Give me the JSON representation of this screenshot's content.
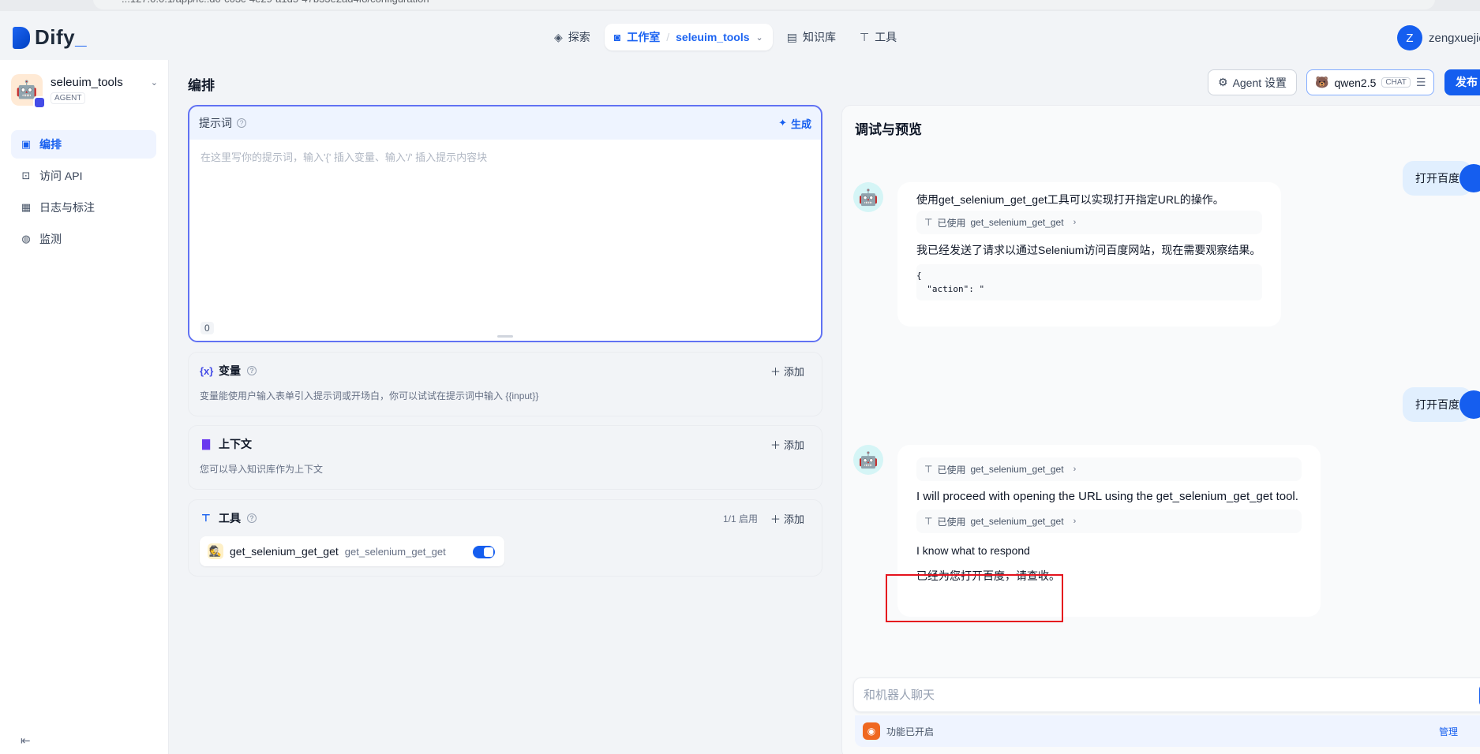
{
  "browser": {
    "url": "...127.0.0.1/app/fc..d0-c03c-4e29-a1d5-47b33e2ad4f8/configuration"
  },
  "nav": {
    "logo": "Dify",
    "explore": "探索",
    "studio": "工作室",
    "current_app": "seleuim_tools",
    "knowledge": "知识库",
    "tools": "工具",
    "user_initial": "Z",
    "user_name": "zengxuejie"
  },
  "sidebar": {
    "app_name": "seleuim_tools",
    "app_type": "AGENT",
    "items": [
      {
        "label": "编排",
        "icon": "layout-icon",
        "active": true
      },
      {
        "label": "访问 API",
        "icon": "terminal-icon",
        "active": false
      },
      {
        "label": "日志与标注",
        "icon": "file-text-icon",
        "active": false
      },
      {
        "label": "监测",
        "icon": "gauge-icon",
        "active": false
      }
    ]
  },
  "main": {
    "title": "编排",
    "agent_settings": "Agent 设置",
    "model_name": "qwen2.5",
    "model_tag": "CHAT",
    "publish": "发布"
  },
  "prompt": {
    "title": "提示词",
    "generate": "生成",
    "placeholder": "在这里写你的提示词，输入'{' 插入变量、输入'/' 插入提示内容块",
    "value": "",
    "char_count": "0"
  },
  "variables": {
    "title": "变量",
    "add": "添加",
    "description": "变量能使用户输入表单引入提示词或开场白，你可以试试在提示词中输入 {{input}}"
  },
  "context": {
    "title": "上下文",
    "add": "添加",
    "description": "您可以导入知识库作为上下文"
  },
  "tools": {
    "title": "工具",
    "enabled_count": "1/1 启用",
    "add": "添加",
    "items": [
      {
        "name": "get_selenium_get_get",
        "subtitle": "get_selenium_get_get",
        "enabled": true
      }
    ]
  },
  "debug": {
    "title": "调试与预览",
    "messages": [
      {
        "role": "user",
        "text": "打开百度"
      },
      {
        "role": "assistant",
        "intro": "使用get_selenium_get_get工具可以实现打开指定URL的操作。",
        "used_tool_prefix": "已使用",
        "used_tool": "get_selenium_get_get",
        "body": "我已经发送了请求以通过Selenium访问百度网站，现在需要观察结果。",
        "code_line1": "{",
        "code_line2": "  \"action\": \""
      },
      {
        "role": "user",
        "text": "打开百度"
      },
      {
        "role": "assistant",
        "used_tool_prefix": "已使用",
        "used_tool_1": "get_selenium_get_get",
        "line1": "I will proceed with opening the URL using the get_selenium_get_get tool.",
        "used_tool_2": "get_selenium_get_get",
        "line2": "I know what to respond",
        "line3": "已经为您打开百度，请查收。"
      }
    ],
    "chat_placeholder": "和机器人聊天",
    "features_label": "功能已开启",
    "manage": "管理"
  },
  "colors": {
    "primary": "#155eef",
    "highlight": "#e5131e",
    "prompt_border": "#6172f3"
  }
}
